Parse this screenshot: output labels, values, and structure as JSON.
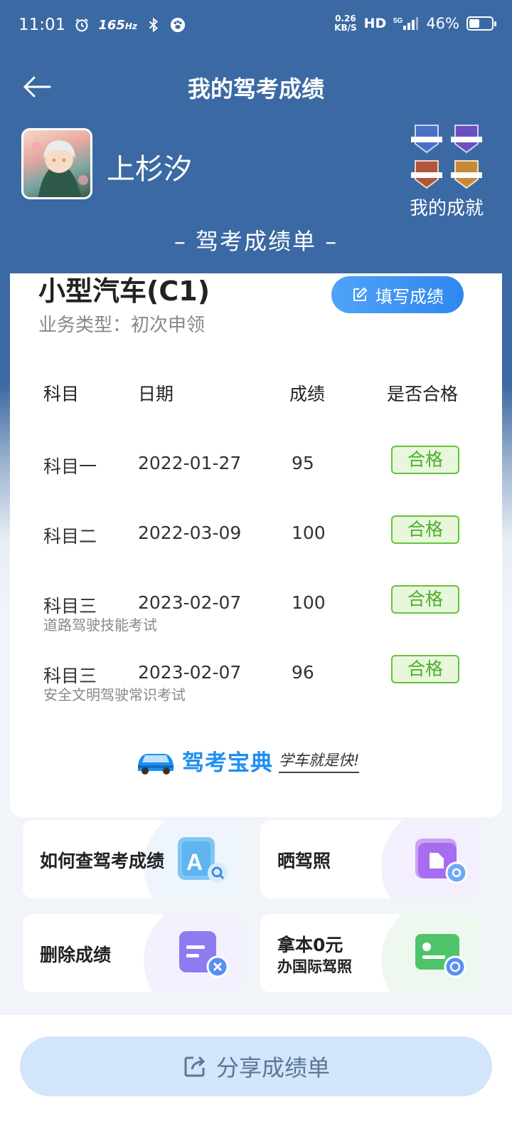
{
  "status_bar": {
    "time": "11:01",
    "refresh_rate": "165",
    "refresh_unit": "Hz",
    "net_speed_value": "0.26",
    "net_speed_unit": "KB/S",
    "hd": "HD",
    "network": "5G",
    "battery": "46%",
    "battery_level": 0.46
  },
  "header": {
    "title": "我的驾考成绩"
  },
  "profile": {
    "name": "上杉汐",
    "achievements_label": "我的成就"
  },
  "section_title": "– 驾考成绩单 –",
  "card": {
    "license_type": "小型汽车(C1)",
    "business_type": "业务类型：初次申领",
    "fill_button": "填写成绩",
    "columns": [
      "科目",
      "日期",
      "成绩",
      "是否合格"
    ],
    "rows": [
      {
        "subject": "科目一",
        "date": "2022-01-27",
        "score": "95",
        "status": "合格",
        "note": ""
      },
      {
        "subject": "科目二",
        "date": "2022-03-09",
        "score": "100",
        "status": "合格",
        "note": ""
      },
      {
        "subject": "科目三",
        "date": "2023-02-07",
        "score": "100",
        "status": "合格",
        "note": "道路驾驶技能考试"
      },
      {
        "subject": "科目三",
        "date": "2023-02-07",
        "score": "96",
        "status": "合格",
        "note": "安全文明驾驶常识考试"
      }
    ],
    "brand": {
      "name": "驾考宝典",
      "slogan": "学车就是快!"
    }
  },
  "tiles": [
    {
      "label": "如何查驾考成绩",
      "icon": "search-document-icon"
    },
    {
      "label": "晒驾照",
      "icon": "photo-share-icon"
    },
    {
      "label": "删除成绩",
      "icon": "delete-record-icon"
    },
    {
      "label_line1": "拿本0元",
      "label_line2": "办国际驾照",
      "icon": "international-license-icon"
    }
  ],
  "share_button": "分享成绩单",
  "colors": {
    "header_blue": "#3b69a3",
    "pass_green": "#67c23a",
    "button_blue": "#2f86ee",
    "share_bg": "#d3e5fb"
  }
}
